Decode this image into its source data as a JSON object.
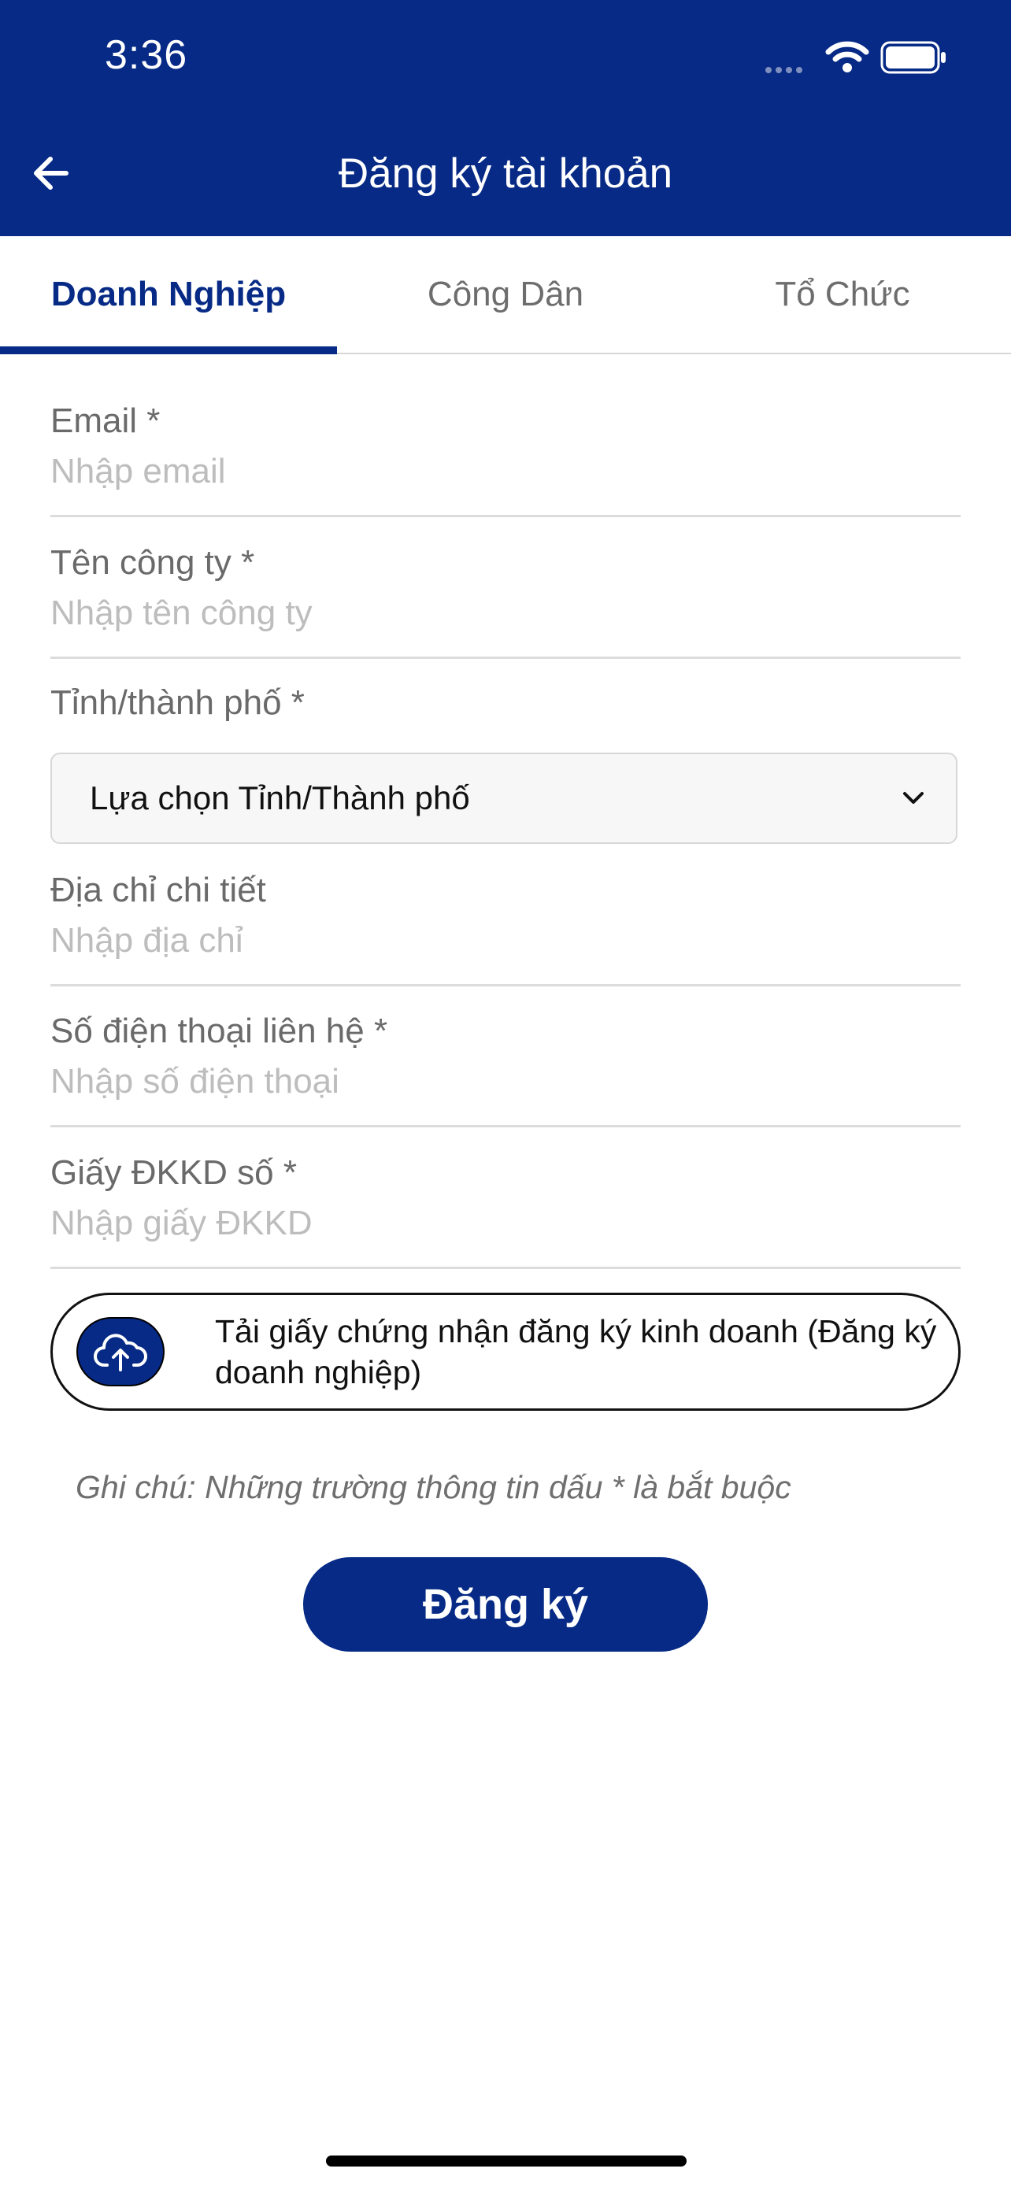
{
  "status_bar": {
    "time": "3:36"
  },
  "header": {
    "title": "Đăng ký tài khoản",
    "back_icon": "arrow-left-icon"
  },
  "tabs": [
    {
      "label": "Doanh Nghiệp",
      "active": true
    },
    {
      "label": "Công Dân",
      "active": false
    },
    {
      "label": "Tổ Chức",
      "active": false
    }
  ],
  "form": {
    "email": {
      "label": "Email *",
      "placeholder": "Nhập email",
      "value": ""
    },
    "company": {
      "label": "Tên công ty *",
      "placeholder": "Nhập tên công ty",
      "value": ""
    },
    "province": {
      "label": "Tỉnh/thành phố *",
      "selected": "Lựa chọn Tỉnh/Thành phố"
    },
    "address": {
      "label": "Địa chỉ chi tiết",
      "placeholder": "Nhập địa chỉ",
      "value": ""
    },
    "phone": {
      "label": "Số điện thoại liên hệ *",
      "placeholder": "Nhập số điện thoại",
      "value": ""
    },
    "license": {
      "label": "Giấy ĐKKD số *",
      "placeholder": "Nhập giấy ĐKKD",
      "value": ""
    }
  },
  "upload": {
    "text": "Tải giấy chứng nhận đăng ký kinh doanh (Đăng ký doanh nghiệp)",
    "icon": "cloud-upload-icon"
  },
  "note": "Ghi chú: Những trường thông tin dấu * là bắt buộc",
  "submit_label": "Đăng ký",
  "colors": {
    "primary": "#062a85",
    "placeholder": "#bdbdbd",
    "label": "#6a6a6a"
  }
}
